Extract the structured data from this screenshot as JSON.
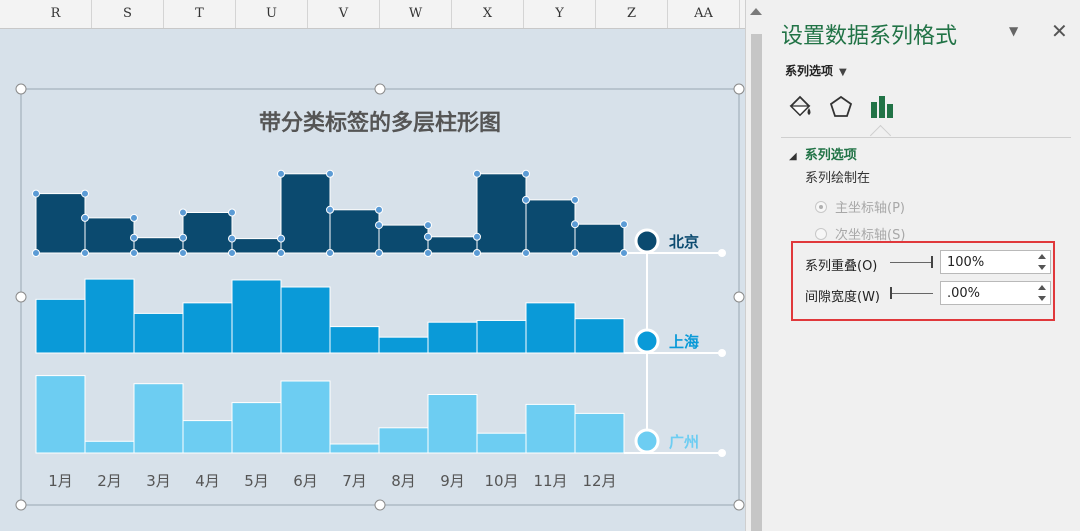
{
  "spreadsheet": {
    "columns": [
      "R",
      "S",
      "T",
      "U",
      "V",
      "W",
      "X",
      "Y",
      "Z",
      "AA"
    ]
  },
  "chart_data": {
    "type": "bar",
    "title": "带分类标签的多层柱形图",
    "categories": [
      "1月",
      "2月",
      "3月",
      "4月",
      "5月",
      "6月",
      "7月",
      "8月",
      "9月",
      "10月",
      "11月",
      "12月"
    ],
    "series": [
      {
        "name": "北京",
        "color": "#0b4a6f",
        "values": [
          66,
          39,
          17,
          45,
          16,
          88,
          48,
          31,
          18,
          88,
          59,
          32
        ]
      },
      {
        "name": "上海",
        "color": "#0a9ad8",
        "values": [
          61,
          84,
          45,
          57,
          83,
          75,
          30,
          18,
          35,
          37,
          57,
          39
        ]
      },
      {
        "name": "广州",
        "color": "#6dcdf2",
        "values": [
          86,
          13,
          77,
          36,
          56,
          80,
          10,
          28,
          65,
          22,
          54,
          44
        ]
      }
    ],
    "ylim": [
      0,
      100
    ],
    "legend": "right",
    "grid": false,
    "selected_series": "北京"
  },
  "pane": {
    "title": "设置数据系列格式",
    "options_menu": "系列选项",
    "tabs": [
      {
        "name": "fill-line",
        "icon": "paint-bucket-icon"
      },
      {
        "name": "effects",
        "icon": "pentagon-icon"
      },
      {
        "name": "series-options",
        "icon": "bar-chart-icon",
        "active": true
      }
    ],
    "section_title": "系列选项",
    "plot_on_label": "系列绘制在",
    "primary_axis": "主坐标轴(P)",
    "secondary_axis": "次坐标轴(S)",
    "primary_axis_selected": true,
    "overlap_label": "系列重叠(O)",
    "overlap_value": "100%",
    "overlap_slider": 1.0,
    "gap_label": "间隙宽度(W)",
    "gap_value": ".00%",
    "gap_slider": 0.0,
    "accent": "#217346",
    "highlight_color": "#e0383b"
  }
}
